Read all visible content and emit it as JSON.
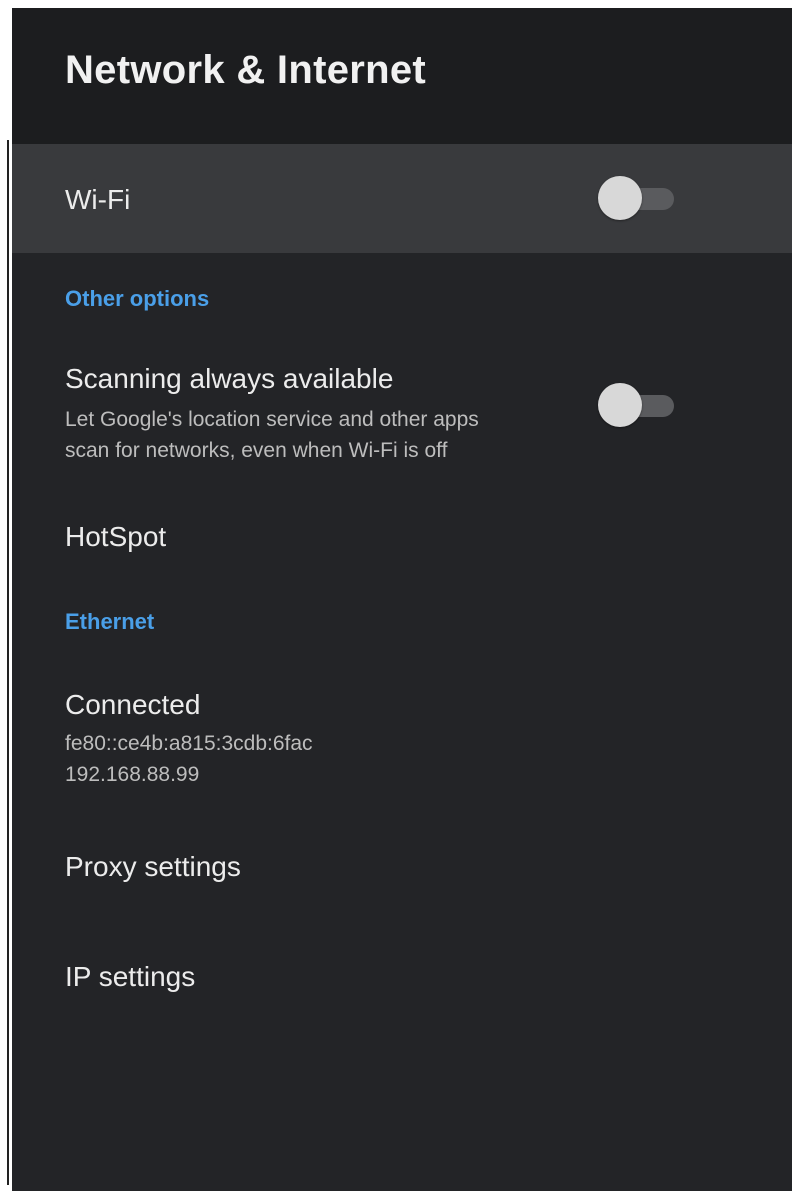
{
  "header": {
    "title": "Network & Internet"
  },
  "wifi": {
    "label": "Wi-Fi",
    "enabled": false
  },
  "other_options": {
    "section_label": "Other options",
    "scanning": {
      "title": "Scanning always available",
      "description_line1": "Let Google's location service and other apps",
      "description_line2": "scan for networks, even when Wi-Fi is off",
      "enabled": false
    },
    "hotspot": {
      "label": "HotSpot"
    }
  },
  "ethernet": {
    "section_label": "Ethernet",
    "status": {
      "title": "Connected",
      "ipv6": "fe80::ce4b:a815:3cdb:6fac",
      "ipv4": "192.168.88.99"
    },
    "proxy": {
      "label": "Proxy settings"
    },
    "ip": {
      "label": "IP settings"
    }
  },
  "colors": {
    "background": "#232427",
    "header_background": "#1c1d1f",
    "focused_row": "#393a3d",
    "accent": "#4a9fe8"
  }
}
